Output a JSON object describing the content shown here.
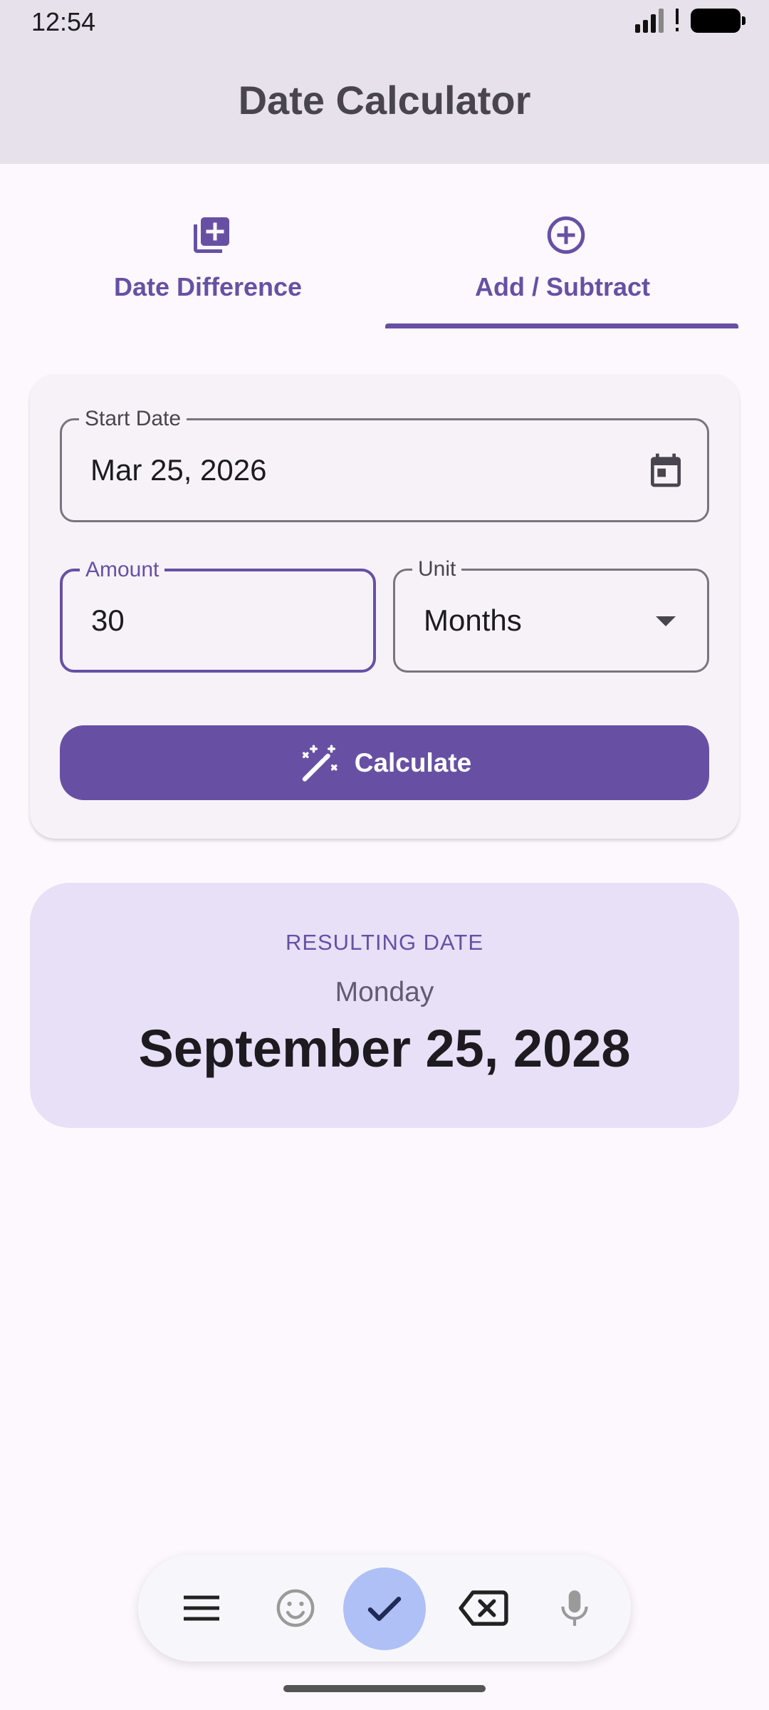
{
  "status_bar": {
    "time": "12:54"
  },
  "app_bar": {
    "title": "Date Calculator"
  },
  "tabs": [
    {
      "label": "Date Difference",
      "icon": "note-add-icon",
      "selected": false
    },
    {
      "label": "Add / Subtract",
      "icon": "add-circle-icon",
      "selected": true
    }
  ],
  "form": {
    "start_date": {
      "label": "Start Date",
      "value": "Mar 25, 2026"
    },
    "amount": {
      "label": "Amount",
      "value": "30"
    },
    "unit": {
      "label": "Unit",
      "value": "Months"
    },
    "calculate_label": "Calculate"
  },
  "result": {
    "label": "RESULTING DATE",
    "day": "Monday",
    "date": "September 25, 2028"
  },
  "colors": {
    "primary": "#6750a4",
    "result_bg": "#e7e0f6",
    "app_bar_bg": "#e6e1ea",
    "ime_check_bg": "#aec0f5"
  },
  "keyboard_toolbar": {
    "icons": [
      "menu-icon",
      "emoji-icon",
      "check-icon",
      "backspace-icon",
      "mic-icon"
    ]
  }
}
